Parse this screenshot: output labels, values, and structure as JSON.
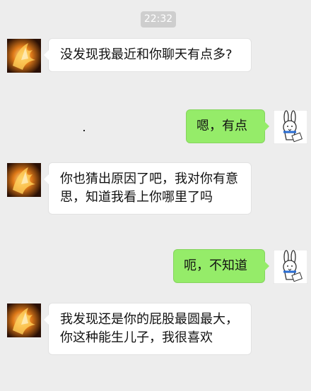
{
  "chat": {
    "timestamp": "22:32",
    "messages": [
      {
        "sender": "contact",
        "text": "没发现我最近和你聊天有点多?"
      },
      {
        "sender": "me",
        "text": "嗯，有点"
      },
      {
        "sender": "contact",
        "text": "你也猜出原因了吧，我对你有意思，知道我看上你哪里了吗"
      },
      {
        "sender": "me",
        "text": "呃，不知道"
      },
      {
        "sender": "contact",
        "text": "我发现还是你的屁股最圆最大，你这种能生儿子，我很喜欢"
      }
    ]
  },
  "colors": {
    "background": "#ededed",
    "sent_bubble": "#95ec69",
    "received_bubble": "#ffffff",
    "timestamp_pill": "#cecece"
  },
  "avatars": {
    "contact": "fiery-angel-avatar-icon",
    "me": "rabbit-avatar-icon"
  }
}
